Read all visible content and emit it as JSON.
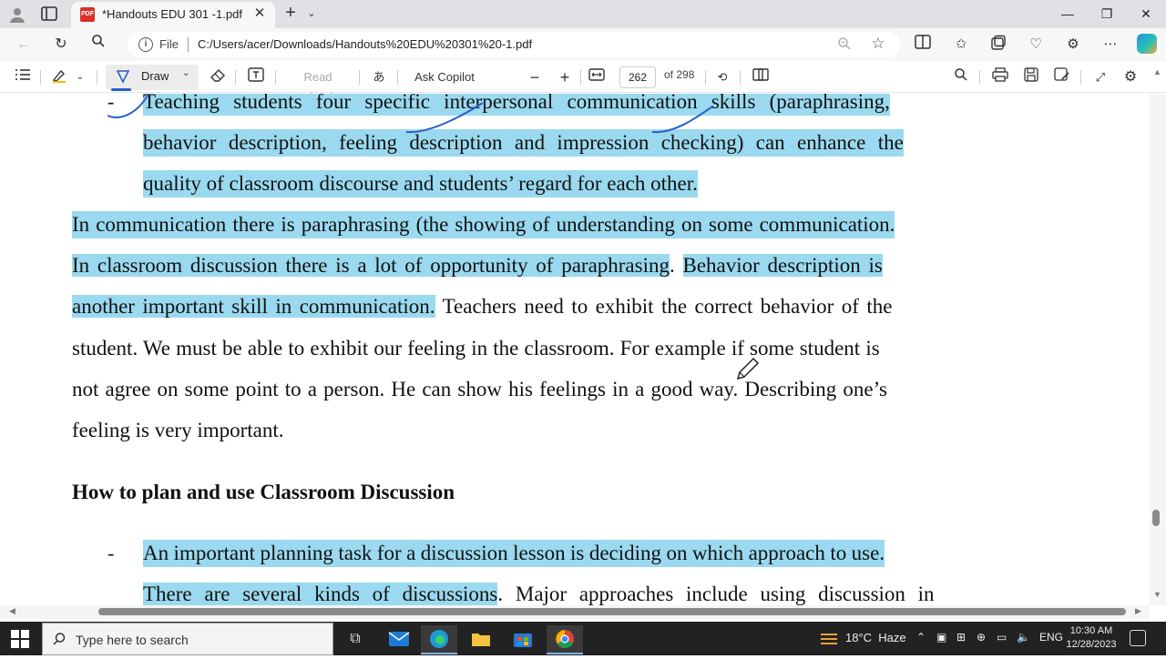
{
  "browser": {
    "tab": {
      "title": "*Handouts EDU 301 -1.pdf",
      "favicon_text": "PDF"
    },
    "address": {
      "scheme_label": "File",
      "url": "C:/Users/acer/Downloads/Handouts%20EDU%20301%20-1.pdf"
    }
  },
  "pdf_toolbar": {
    "draw_label": "Draw",
    "read_aloud_label": "Read aloud",
    "ask_copilot_label": "Ask Copilot",
    "page_current": "262",
    "page_total": "of 298"
  },
  "document": {
    "bullet1": [
      "Teaching students four specific interpersonal communication skills (paraphrasing,",
      "behavior description, feeling description and impression checking) can enhance the",
      "quality of classroom discourse and students’ regard for each other."
    ],
    "para": {
      "l1": "In communication there is paraphrasing (the showing of understanding on some communication.",
      "l2_hl": "In classroom discussion there is a lot of opportunity of paraphrasing",
      "l2_dot": ".",
      "l2_hl2": "Behavior description is",
      "l3_hl": "another important skill in communication.",
      "l3_rest": "Teachers need to exhibit the correct behavior of the",
      "l4": "student. We must be able to exhibit our feeling in the classroom. For example if some student is",
      "l5": "not agree on some point to a person. He can show his feelings in a good way. Describing one’s",
      "l6": "feeling is very important."
    },
    "heading": "How to plan and use Classroom Discussion",
    "bullet2": {
      "l1": "An important planning task for a discussion lesson is deciding on which approach to use.",
      "l2_hl": "There are several kinds of discussions",
      "l2_rest": ". Major approaches include using discussion in"
    },
    "dash": "-"
  },
  "taskbar": {
    "search_placeholder": "Type here to search",
    "weather": "18°C  Haze",
    "language": "ENG",
    "time": "10:30 AM",
    "date": "12/28/2023"
  }
}
